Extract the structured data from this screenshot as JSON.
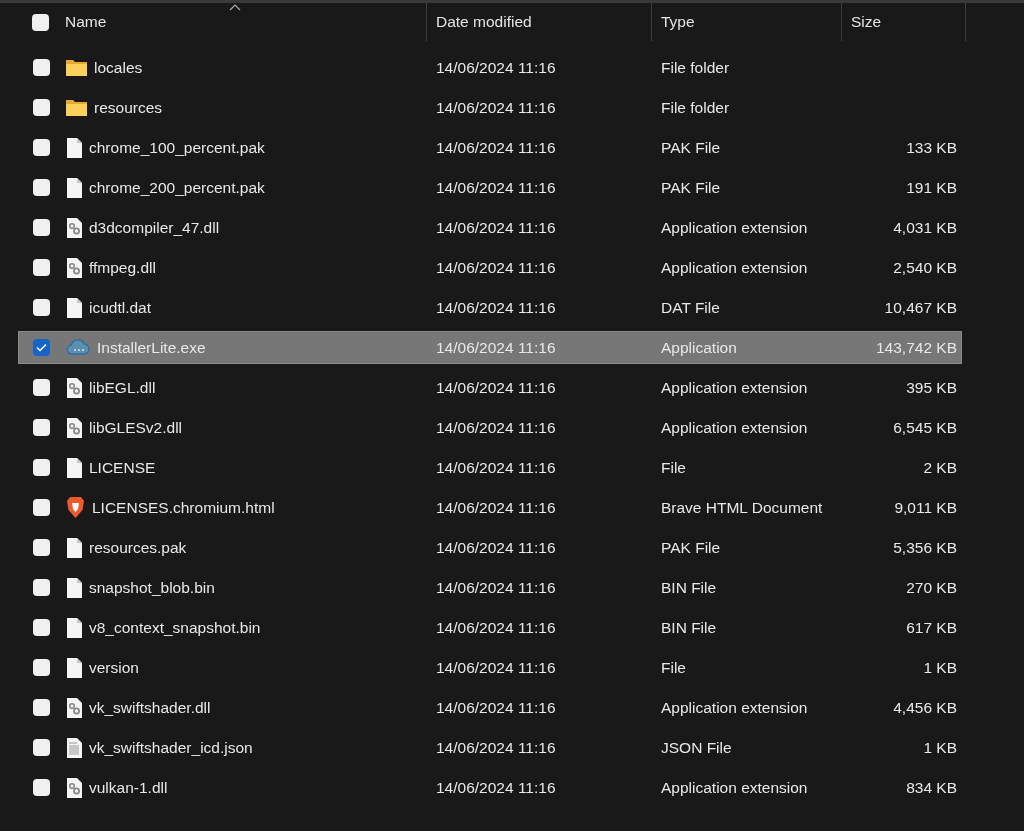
{
  "columns": [
    {
      "label": "Name",
      "sorted": true
    },
    {
      "label": "Date modified",
      "sorted": false
    },
    {
      "label": "Type",
      "sorted": false
    },
    {
      "label": "Size",
      "sorted": false
    }
  ],
  "select_all": {
    "checked": false
  },
  "rows": [
    {
      "name": "locales",
      "date": "14/06/2024 11:16",
      "type": "File folder",
      "kind": "folder",
      "selected": false
    },
    {
      "name": "resources",
      "date": "14/06/2024 11:16",
      "type": "File folder",
      "kind": "folder",
      "selected": false
    },
    {
      "name": "chrome_100_percent.pak",
      "date": "14/06/2024 11:16",
      "type": "PAK File",
      "size": "133 KB",
      "kind": "file",
      "selected": false
    },
    {
      "name": "chrome_200_percent.pak",
      "date": "14/06/2024 11:16",
      "type": "PAK File",
      "size": "191 KB",
      "kind": "file",
      "selected": false
    },
    {
      "name": "d3dcompiler_47.dll",
      "date": "14/06/2024 11:16",
      "type": "Application extension",
      "size": "4,031 KB",
      "kind": "dll",
      "selected": false
    },
    {
      "name": "ffmpeg.dll",
      "date": "14/06/2024 11:16",
      "type": "Application extension",
      "size": "2,540 KB",
      "kind": "dll",
      "selected": false
    },
    {
      "name": "icudtl.dat",
      "date": "14/06/2024 11:16",
      "type": "DAT File",
      "size": "10,467 KB",
      "kind": "file",
      "selected": false
    },
    {
      "name": "InstallerLite.exe",
      "date": "14/06/2024 11:16",
      "type": "Application",
      "size": "143,742 KB",
      "kind": "app",
      "selected": true
    },
    {
      "name": "libEGL.dll",
      "date": "14/06/2024 11:16",
      "type": "Application extension",
      "size": "395 KB",
      "kind": "dll",
      "selected": false
    },
    {
      "name": "libGLESv2.dll",
      "date": "14/06/2024 11:16",
      "type": "Application extension",
      "size": "6,545 KB",
      "kind": "dll",
      "selected": false
    },
    {
      "name": "LICENSE",
      "date": "14/06/2024 11:16",
      "type": "File",
      "size": "2 KB",
      "kind": "file",
      "selected": false
    },
    {
      "name": "LICENSES.chromium.html",
      "date": "14/06/2024 11:16",
      "type": "Brave HTML Document",
      "size": "9,011 KB",
      "kind": "browser",
      "selected": false
    },
    {
      "name": "resources.pak",
      "date": "14/06/2024 11:16",
      "type": "PAK File",
      "size": "5,356 KB",
      "kind": "file",
      "selected": false
    },
    {
      "name": "snapshot_blob.bin",
      "date": "14/06/2024 11:16",
      "type": "BIN File",
      "size": "270 KB",
      "kind": "file",
      "selected": false
    },
    {
      "name": "v8_context_snapshot.bin",
      "date": "14/06/2024 11:16",
      "type": "BIN File",
      "size": "617 KB",
      "kind": "file",
      "selected": false
    },
    {
      "name": "version",
      "date": "14/06/2024 11:16",
      "type": "File",
      "size": "1 KB",
      "kind": "file",
      "selected": false
    },
    {
      "name": "vk_swiftshader.dll",
      "date": "14/06/2024 11:16",
      "type": "Application extension",
      "size": "4,456 KB",
      "kind": "dll",
      "selected": false
    },
    {
      "name": "vk_swiftshader_icd.json",
      "date": "14/06/2024 11:16",
      "type": "JSON File",
      "size": "1 KB",
      "kind": "text",
      "selected": false
    },
    {
      "name": "vulkan-1.dll",
      "date": "14/06/2024 11:16",
      "type": "Application extension",
      "size": "834 KB",
      "kind": "dll",
      "selected": false
    }
  ]
}
